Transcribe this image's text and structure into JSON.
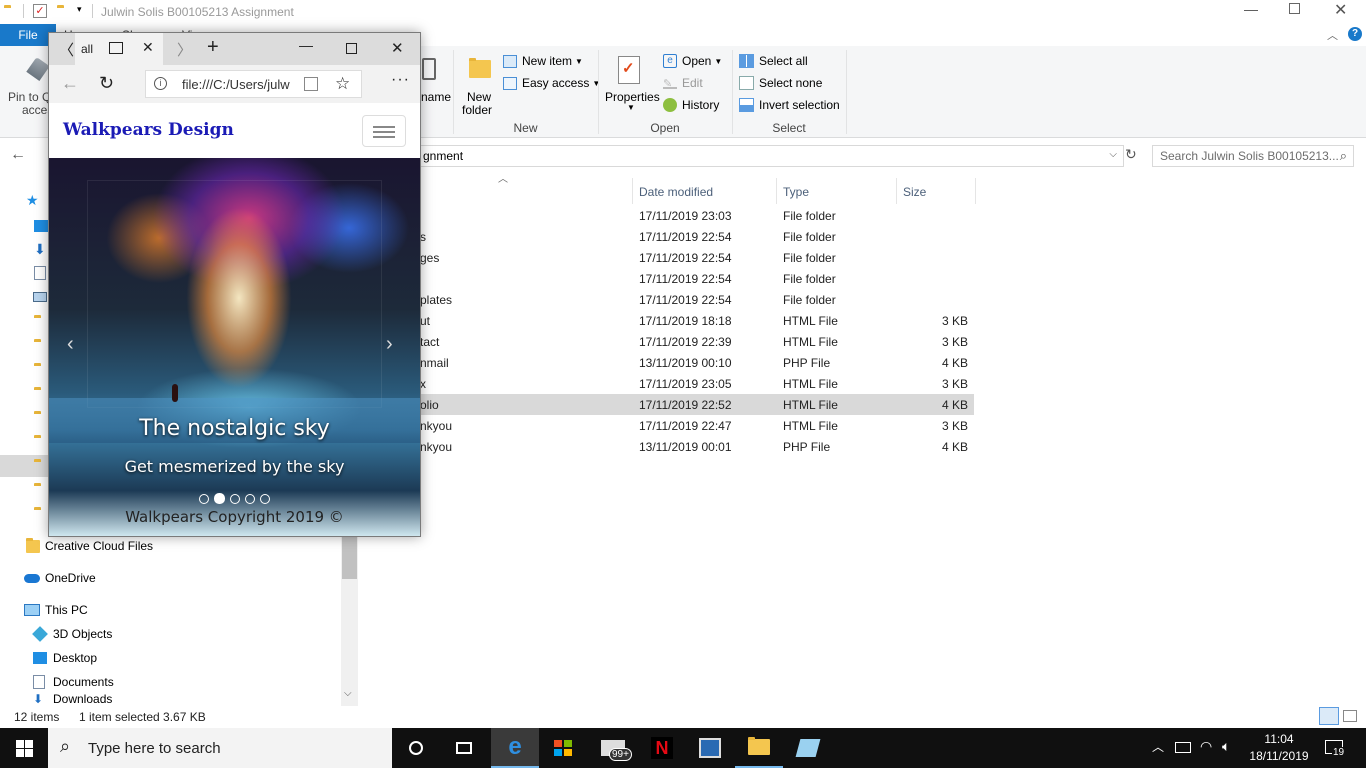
{
  "explorer": {
    "title": "Julwin Solis B00105213 Assignment",
    "tabs": {
      "file": "File",
      "home": "Home",
      "share": "Share",
      "view": "View"
    },
    "ribbon": {
      "pin_label_1": "Pin to Q",
      "pin_label_2": "acces",
      "rename_label": "name",
      "new_folder_1": "New",
      "new_folder_2": "folder",
      "new_item": "New item",
      "easy_access": "Easy access",
      "group_new": "New",
      "properties": "Properties",
      "open": "Open",
      "edit": "Edit",
      "history": "History",
      "group_open": "Open",
      "select_all": "Select all",
      "select_none": "Select none",
      "invert_selection": "Invert selection",
      "group_select": "Select"
    },
    "address": "gnment",
    "search_placeholder": "Search Julwin Solis B00105213...",
    "columns": {
      "date": "Date modified",
      "type": "Type",
      "size": "Size"
    },
    "files": [
      {
        "name": "",
        "date": "17/11/2019 23:03",
        "type": "File folder",
        "size": ""
      },
      {
        "name": "s",
        "date": "17/11/2019 22:54",
        "type": "File folder",
        "size": ""
      },
      {
        "name": "ges",
        "date": "17/11/2019 22:54",
        "type": "File folder",
        "size": ""
      },
      {
        "name": "",
        "date": "17/11/2019 22:54",
        "type": "File folder",
        "size": ""
      },
      {
        "name": "plates",
        "date": "17/11/2019 22:54",
        "type": "File folder",
        "size": ""
      },
      {
        "name": "ut",
        "date": "17/11/2019 18:18",
        "type": "HTML File",
        "size": "3 KB"
      },
      {
        "name": "tact",
        "date": "17/11/2019 22:39",
        "type": "HTML File",
        "size": "3 KB"
      },
      {
        "name": "nmail",
        "date": "13/11/2019 00:10",
        "type": "PHP File",
        "size": "4 KB"
      },
      {
        "name": "x",
        "date": "17/11/2019 23:05",
        "type": "HTML File",
        "size": "3 KB"
      },
      {
        "name": "olio",
        "date": "17/11/2019 22:52",
        "type": "HTML File",
        "size": "4 KB"
      },
      {
        "name": "nkyou",
        "date": "17/11/2019 22:47",
        "type": "HTML File",
        "size": "3 KB"
      },
      {
        "name": "nkyou",
        "date": "13/11/2019 00:01",
        "type": "PHP File",
        "size": "4 KB"
      }
    ],
    "nav": {
      "creative_cloud": "Creative Cloud Files",
      "onedrive": "OneDrive",
      "this_pc": "This PC",
      "objects3d": "3D Objects",
      "desktop": "Desktop",
      "documents": "Documents",
      "downloads": "Downloads"
    },
    "status": {
      "items": "12 items",
      "selected": "1 item selected  3.67 KB"
    }
  },
  "edge": {
    "tab_title": "all",
    "url": "file:///C:/Users/julw",
    "site_brand": "Walkpears Design",
    "slide_title": "The nostalgic sky",
    "slide_subtitle": "Get mesmerized by the sky",
    "footer": "Walkpears Copyright 2019 ©",
    "slide_count": 5,
    "active_slide": 2
  },
  "taskbar": {
    "search_placeholder": "Type here to search",
    "time": "11:04",
    "date": "18/11/2019",
    "mail_badge": "99+",
    "notif_badge": "19"
  }
}
